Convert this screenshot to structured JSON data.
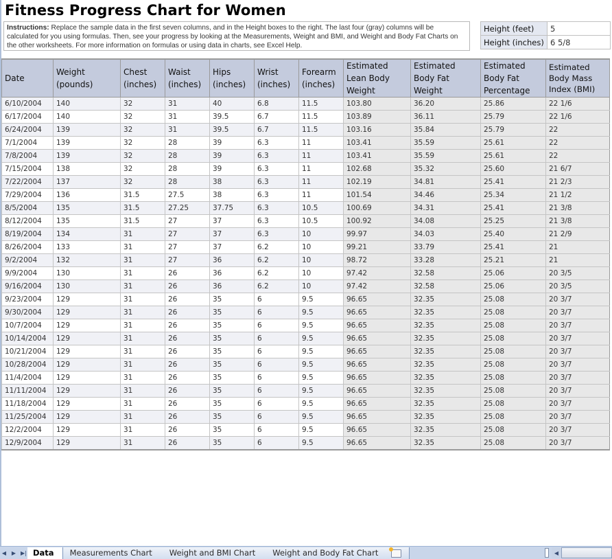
{
  "title": "Fitness Progress Chart for Women",
  "instructions": {
    "label": "Instructions:",
    "text": " Replace the sample data in the first seven columns, and in the Height boxes to the right. The last four (gray) columns will be calculated for you using formulas. Then, see your progress by looking at the Measurements, Weight and BMI, and Weight and Body Fat Charts on the other worksheets. For more information on formulas or using data in charts, see Excel Help."
  },
  "height": {
    "feet_label": "Height (feet)",
    "feet_value": "5",
    "inches_label": "Height (inches)",
    "inches_value": "6 5/8"
  },
  "table": {
    "headers": [
      "Date",
      "Weight (pounds)",
      "Chest (inches)",
      "Waist (inches)",
      "Hips (inches)",
      "Wrist (inches)",
      "Forearm (inches)",
      "Estimated Lean Body Weight",
      "Estimated Body Fat Weight",
      "Estimated Body Fat Percentage",
      "Estimated Body Mass Index (BMI)"
    ],
    "rows": [
      [
        "6/10/2004",
        "140",
        "32",
        "31",
        "40",
        "6.8",
        "11.5",
        "103.80",
        "36.20",
        "25.86",
        "22 1/6"
      ],
      [
        "6/17/2004",
        "140",
        "32",
        "31",
        "39.5",
        "6.7",
        "11.5",
        "103.89",
        "36.11",
        "25.79",
        "22 1/6"
      ],
      [
        "6/24/2004",
        "139",
        "32",
        "31",
        "39.5",
        "6.7",
        "11.5",
        "103.16",
        "35.84",
        "25.79",
        "22"
      ],
      [
        "7/1/2004",
        "139",
        "32",
        "28",
        "39",
        "6.3",
        "11",
        "103.41",
        "35.59",
        "25.61",
        "22"
      ],
      [
        "7/8/2004",
        "139",
        "32",
        "28",
        "39",
        "6.3",
        "11",
        "103.41",
        "35.59",
        "25.61",
        "22"
      ],
      [
        "7/15/2004",
        "138",
        "32",
        "28",
        "39",
        "6.3",
        "11",
        "102.68",
        "35.32",
        "25.60",
        "21 6/7"
      ],
      [
        "7/22/2004",
        "137",
        "32",
        "28",
        "38",
        "6.3",
        "11",
        "102.19",
        "34.81",
        "25.41",
        "21 2/3"
      ],
      [
        "7/29/2004",
        "136",
        "31.5",
        "27.5",
        "38",
        "6.3",
        "11",
        "101.54",
        "34.46",
        "25.34",
        "21 1/2"
      ],
      [
        "8/5/2004",
        "135",
        "31.5",
        "27.25",
        "37.75",
        "6.3",
        "10.5",
        "100.69",
        "34.31",
        "25.41",
        "21 3/8"
      ],
      [
        "8/12/2004",
        "135",
        "31.5",
        "27",
        "37",
        "6.3",
        "10.5",
        "100.92",
        "34.08",
        "25.25",
        "21 3/8"
      ],
      [
        "8/19/2004",
        "134",
        "31",
        "27",
        "37",
        "6.3",
        "10",
        "99.97",
        "34.03",
        "25.40",
        "21 2/9"
      ],
      [
        "8/26/2004",
        "133",
        "31",
        "27",
        "37",
        "6.2",
        "10",
        "99.21",
        "33.79",
        "25.41",
        "21"
      ],
      [
        "9/2/2004",
        "132",
        "31",
        "27",
        "36",
        "6.2",
        "10",
        "98.72",
        "33.28",
        "25.21",
        "21"
      ],
      [
        "9/9/2004",
        "130",
        "31",
        "26",
        "36",
        "6.2",
        "10",
        "97.42",
        "32.58",
        "25.06",
        "20 3/5"
      ],
      [
        "9/16/2004",
        "130",
        "31",
        "26",
        "36",
        "6.2",
        "10",
        "97.42",
        "32.58",
        "25.06",
        "20 3/5"
      ],
      [
        "9/23/2004",
        "129",
        "31",
        "26",
        "35",
        "6",
        "9.5",
        "96.65",
        "32.35",
        "25.08",
        "20 3/7"
      ],
      [
        "9/30/2004",
        "129",
        "31",
        "26",
        "35",
        "6",
        "9.5",
        "96.65",
        "32.35",
        "25.08",
        "20 3/7"
      ],
      [
        "10/7/2004",
        "129",
        "31",
        "26",
        "35",
        "6",
        "9.5",
        "96.65",
        "32.35",
        "25.08",
        "20 3/7"
      ],
      [
        "10/14/2004",
        "129",
        "31",
        "26",
        "35",
        "6",
        "9.5",
        "96.65",
        "32.35",
        "25.08",
        "20 3/7"
      ],
      [
        "10/21/2004",
        "129",
        "31",
        "26",
        "35",
        "6",
        "9.5",
        "96.65",
        "32.35",
        "25.08",
        "20 3/7"
      ],
      [
        "10/28/2004",
        "129",
        "31",
        "26",
        "35",
        "6",
        "9.5",
        "96.65",
        "32.35",
        "25.08",
        "20 3/7"
      ],
      [
        "11/4/2004",
        "129",
        "31",
        "26",
        "35",
        "6",
        "9.5",
        "96.65",
        "32.35",
        "25.08",
        "20 3/7"
      ],
      [
        "11/11/2004",
        "129",
        "31",
        "26",
        "35",
        "6",
        "9.5",
        "96.65",
        "32.35",
        "25.08",
        "20 3/7"
      ],
      [
        "11/18/2004",
        "129",
        "31",
        "26",
        "35",
        "6",
        "9.5",
        "96.65",
        "32.35",
        "25.08",
        "20 3/7"
      ],
      [
        "11/25/2004",
        "129",
        "31",
        "26",
        "35",
        "6",
        "9.5",
        "96.65",
        "32.35",
        "25.08",
        "20 3/7"
      ],
      [
        "12/2/2004",
        "129",
        "31",
        "26",
        "35",
        "6",
        "9.5",
        "96.65",
        "32.35",
        "25.08",
        "20 3/7"
      ],
      [
        "12/9/2004",
        "129",
        "31",
        "26",
        "35",
        "6",
        "9.5",
        "96.65",
        "32.35",
        "25.08",
        "20 3/7"
      ]
    ]
  },
  "sheet_tabs": {
    "nav_icons": [
      "tab-scroll-prev-icon",
      "tab-scroll-next-icon",
      "tab-scroll-last-icon"
    ],
    "tabs": [
      {
        "label": "Data",
        "active": true
      },
      {
        "label": "Measurements Chart",
        "active": false
      },
      {
        "label": "Weight and BMI Chart",
        "active": false
      },
      {
        "label": "Weight and Body Fat Chart",
        "active": false
      }
    ],
    "new_sheet_icon": "insert-worksheet-icon"
  },
  "colors": {
    "header_bg": "#c4cbdd",
    "input_row_alt": "#f0f1f6",
    "calc_col_bg": "#e8e8e8",
    "height_label_bg": "#e4e8f1",
    "tabbar_bg": "#c9d6ea"
  }
}
